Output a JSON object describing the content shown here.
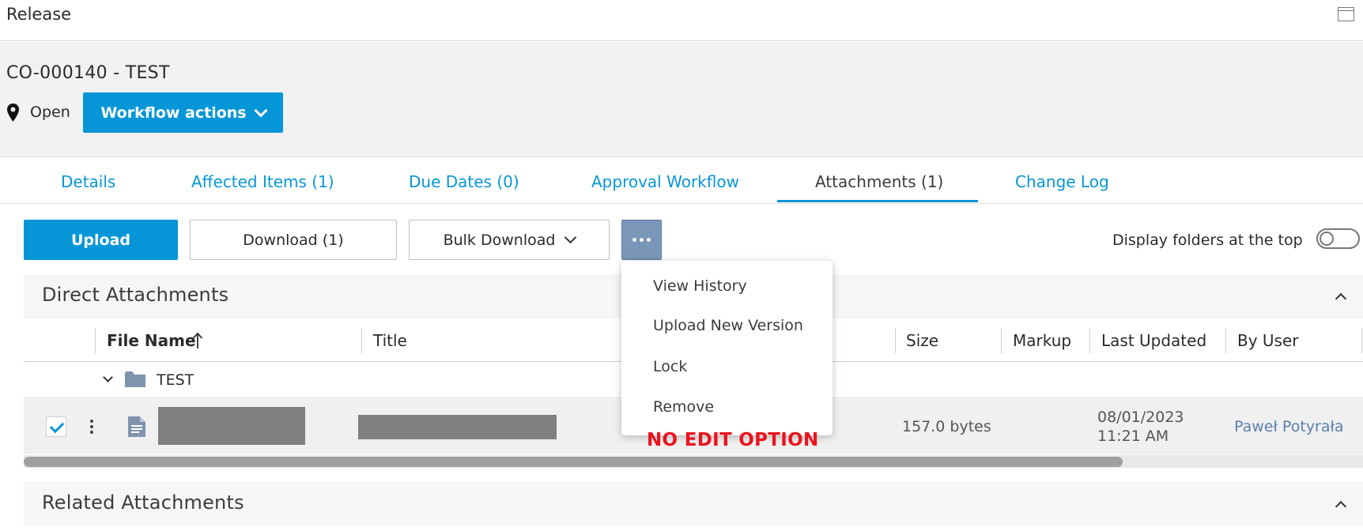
{
  "window": {
    "title": "Release",
    "restore_icon": "window-restore-icon"
  },
  "header": {
    "record_title": "CO-000140 - TEST",
    "state": "Open",
    "state_icon": "map-pin-icon",
    "workflow_button": "Workflow actions"
  },
  "tabs": [
    {
      "label": "Details",
      "active": false
    },
    {
      "label": "Affected Items (1)",
      "active": false
    },
    {
      "label": "Due Dates (0)",
      "active": false
    },
    {
      "label": "Approval Workflow",
      "active": false
    },
    {
      "label": "Attachments (1)",
      "active": true
    },
    {
      "label": "Change Log",
      "active": false
    }
  ],
  "toolbar": {
    "upload": "Upload",
    "download": "Download (1)",
    "bulk_download": "Bulk Download",
    "more_icon": "ellipsis-icon",
    "display_folders_label": "Display folders at the top",
    "display_folders_on": false
  },
  "direct_attachments": {
    "title": "Direct Attachments",
    "columns": [
      "File Name",
      "Title",
      "Size",
      "Markup",
      "Last Updated",
      "By User"
    ],
    "sort_column": "File Name",
    "folder": {
      "name": "TEST",
      "expanded": true
    },
    "rows": [
      {
        "checked": true,
        "file_name": "",
        "title": "",
        "size": "157.0 bytes",
        "markup": "",
        "last_updated_date": "08/01/2023",
        "last_updated_time": "11:21 AM",
        "by_user": "Paweł Potyrała"
      }
    ]
  },
  "context_menu": {
    "items": [
      "View History",
      "Upload New Version",
      "Lock",
      "Remove"
    ]
  },
  "annotation": "NO EDIT OPTION",
  "related_attachments": {
    "title": "Related Attachments"
  },
  "colors": {
    "accent": "#0696d7",
    "more_button": "#7a96b8",
    "annotation": "#e8141f",
    "user_link": "#5a7fb0"
  }
}
